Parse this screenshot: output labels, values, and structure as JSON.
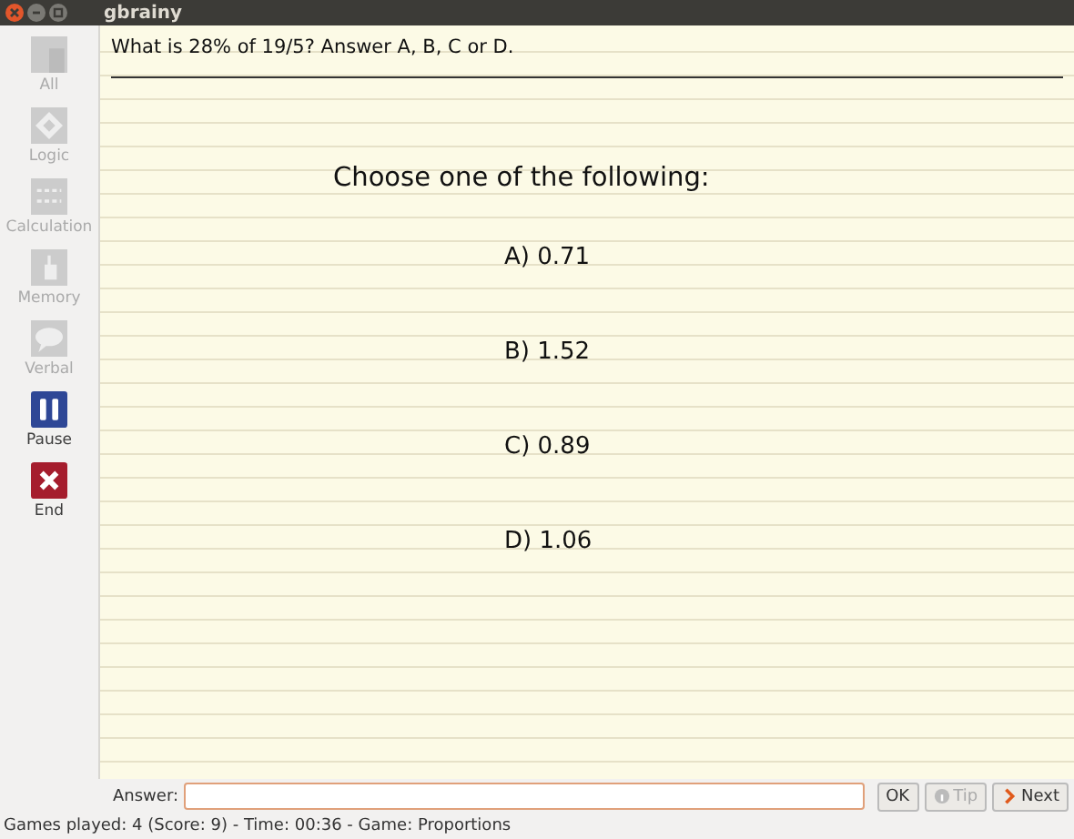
{
  "window": {
    "title": "gbrainy"
  },
  "sidebar": {
    "items": [
      {
        "kind": "all",
        "label": "All",
        "disabled": true
      },
      {
        "kind": "logic",
        "label": "Logic",
        "disabled": true
      },
      {
        "kind": "calculation",
        "label": "Calculation",
        "disabled": true
      },
      {
        "kind": "memory",
        "label": "Memory",
        "disabled": true
      },
      {
        "kind": "verbal",
        "label": "Verbal",
        "disabled": true
      },
      {
        "kind": "pause",
        "label": "Pause",
        "disabled": false
      },
      {
        "kind": "end",
        "label": "End",
        "disabled": false
      }
    ]
  },
  "question": "What is 28% of 19/5? Answer A, B, C or D.",
  "prompt": "Choose one of the following:",
  "options": [
    "A) 0.71",
    "B) 1.52",
    "C) 0.89",
    "D) 1.06"
  ],
  "answer": {
    "label": "Answer:"
  },
  "buttons": [
    {
      "kind": "ok",
      "label": "OK",
      "disabled": false
    },
    {
      "kind": "tip",
      "label": "Tip",
      "disabled": true
    },
    {
      "kind": "next",
      "label": "Next",
      "disabled": false
    }
  ],
  "status_bar": "Games played: 4 (Score: 9) - Time: 00:36 - Game: Proportions"
}
